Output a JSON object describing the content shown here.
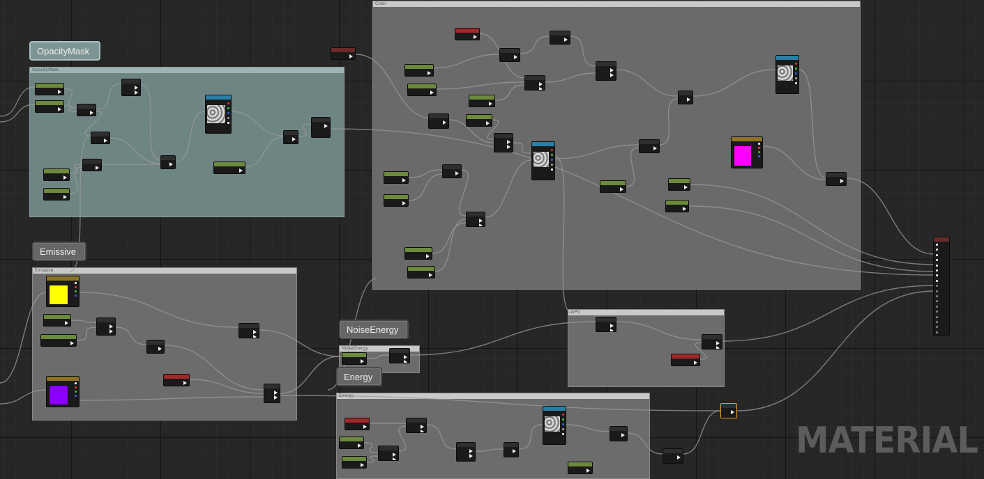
{
  "watermark": "MATERIAL",
  "comments": {
    "opacity_mask": {
      "bubble": "OpacityMask",
      "header": "OpacityMask"
    },
    "emissive": {
      "bubble": "Emissive",
      "header": "Emissive"
    },
    "noise_energy": {
      "bubble": "NoiseEnergy",
      "header": "NoiseEnergy"
    },
    "energy": {
      "bubble": "Energy",
      "header": "Energy"
    },
    "color": {
      "header": "Color"
    },
    "wpo": {
      "header": "WPO"
    }
  },
  "colors": {
    "comment_blue": "#7d9594",
    "comment_gray": "#7c7c7c",
    "param_green": "#6c8a3c",
    "texture_blue": "#2a7fa8",
    "vector_gold": "#8c7326",
    "red_node": "#a12828",
    "swatch_yellow": "#ffff00",
    "swatch_violet": "#8b00ff",
    "swatch_magenta": "#ff00ff",
    "wire": "#9a9a9a",
    "selection": "#f0a020"
  }
}
